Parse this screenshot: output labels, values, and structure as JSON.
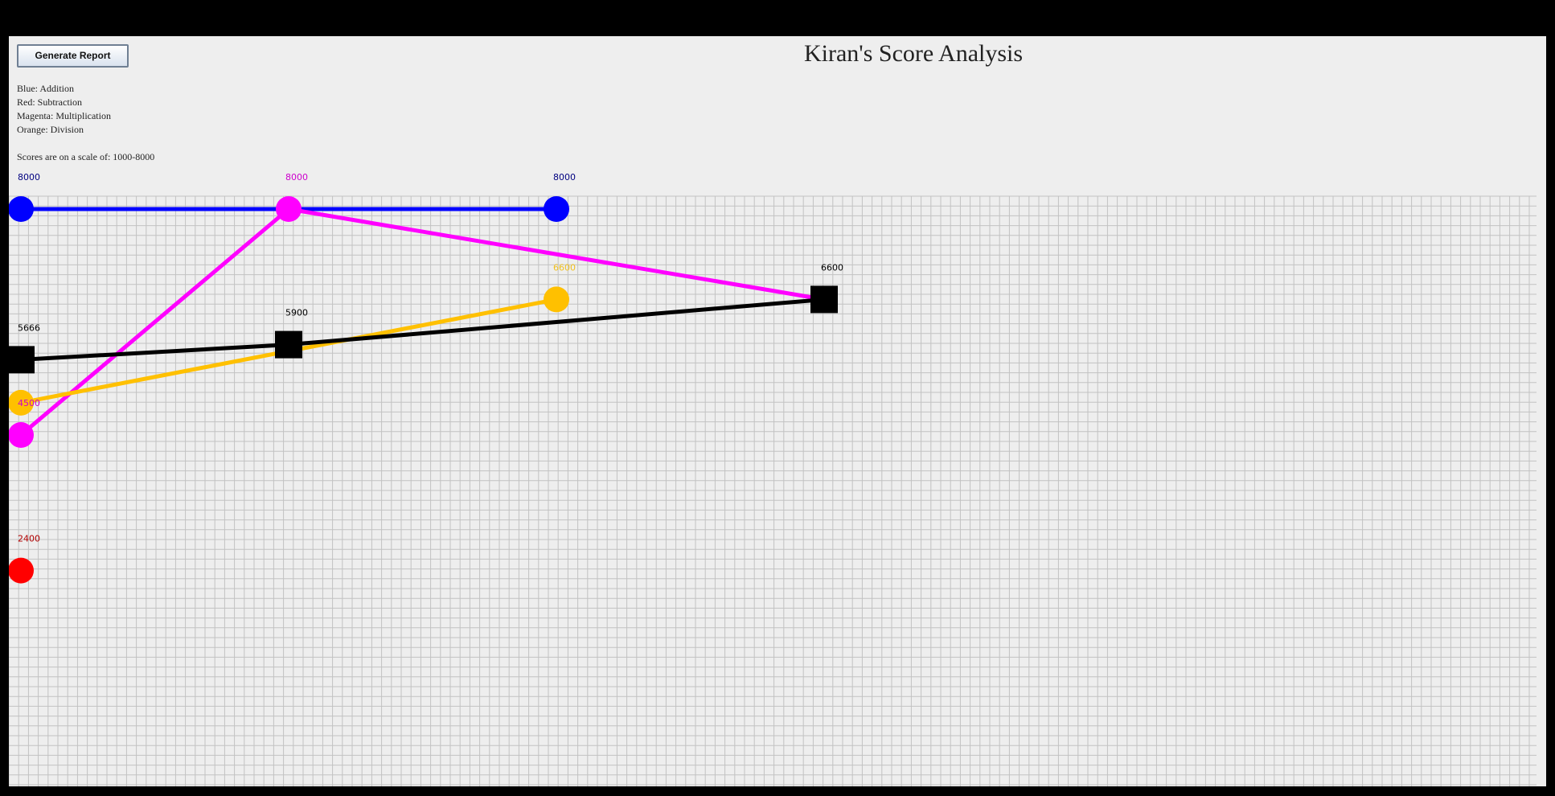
{
  "toolbar": {
    "generate_label": "Generate Report"
  },
  "page": {
    "title": "Kiran's Score Analysis"
  },
  "legend": {
    "lines": [
      "Blue: Addition",
      "Red: Subtraction",
      "Magenta: Multiplication",
      "Orange: Division"
    ],
    "scale_note": "Scores are on a scale of: 1000-8000"
  },
  "chart_data": {
    "type": "line",
    "x": [
      1,
      2,
      3,
      4
    ],
    "ylim": [
      1000,
      8000
    ],
    "grid": true,
    "series": [
      {
        "name": "Addition",
        "color": "#0000ff",
        "marker": "circle",
        "values": [
          8000,
          null,
          8000,
          null
        ],
        "points": [
          [
            1,
            8000
          ],
          [
            3,
            8000
          ]
        ]
      },
      {
        "name": "Subtraction",
        "color": "#ff0000",
        "marker": "circle",
        "label_color": "#b00000",
        "points": [
          [
            1,
            2400
          ]
        ]
      },
      {
        "name": "Multiplication",
        "color": "#ff00ff",
        "marker": "circle",
        "label_color": "#cc00cc",
        "points": [
          [
            1,
            4500
          ],
          [
            2,
            8000
          ],
          [
            4,
            6600
          ]
        ]
      },
      {
        "name": "Division",
        "color": "#ffc000",
        "marker": "circle",
        "label_color": "#f0c020",
        "points": [
          [
            1,
            5000
          ],
          [
            3,
            6600
          ]
        ]
      },
      {
        "color": "#000000",
        "marker": "square",
        "points": [
          [
            1,
            5666
          ],
          [
            2,
            5900
          ],
          [
            4,
            6600
          ]
        ]
      }
    ],
    "data_labels": [
      {
        "series": 0,
        "x": 1,
        "y": 8000,
        "text": "8000",
        "color": "#000080"
      },
      {
        "series": 2,
        "x": 2,
        "y": 8000,
        "text": "8000",
        "color": "#cc00cc"
      },
      {
        "series": 0,
        "x": 3,
        "y": 8000,
        "text": "8000",
        "color": "#000080"
      },
      {
        "series": 3,
        "x": 3,
        "y": 6600,
        "text": "6600",
        "color": "#f0c020"
      },
      {
        "series": 4,
        "x": 4,
        "y": 6600,
        "text": "6600",
        "color": "#000000"
      },
      {
        "series": 4,
        "x": 2,
        "y": 5900,
        "text": "5900",
        "color": "#000000"
      },
      {
        "series": 4,
        "x": 1,
        "y": 5666,
        "text": "5666",
        "color": "#000000"
      },
      {
        "series": 2,
        "x": 1,
        "y": 4500,
        "text": "4500",
        "color": "#cc00cc"
      },
      {
        "series": 1,
        "x": 1,
        "y": 2400,
        "text": "2400",
        "color": "#b00000"
      }
    ]
  }
}
